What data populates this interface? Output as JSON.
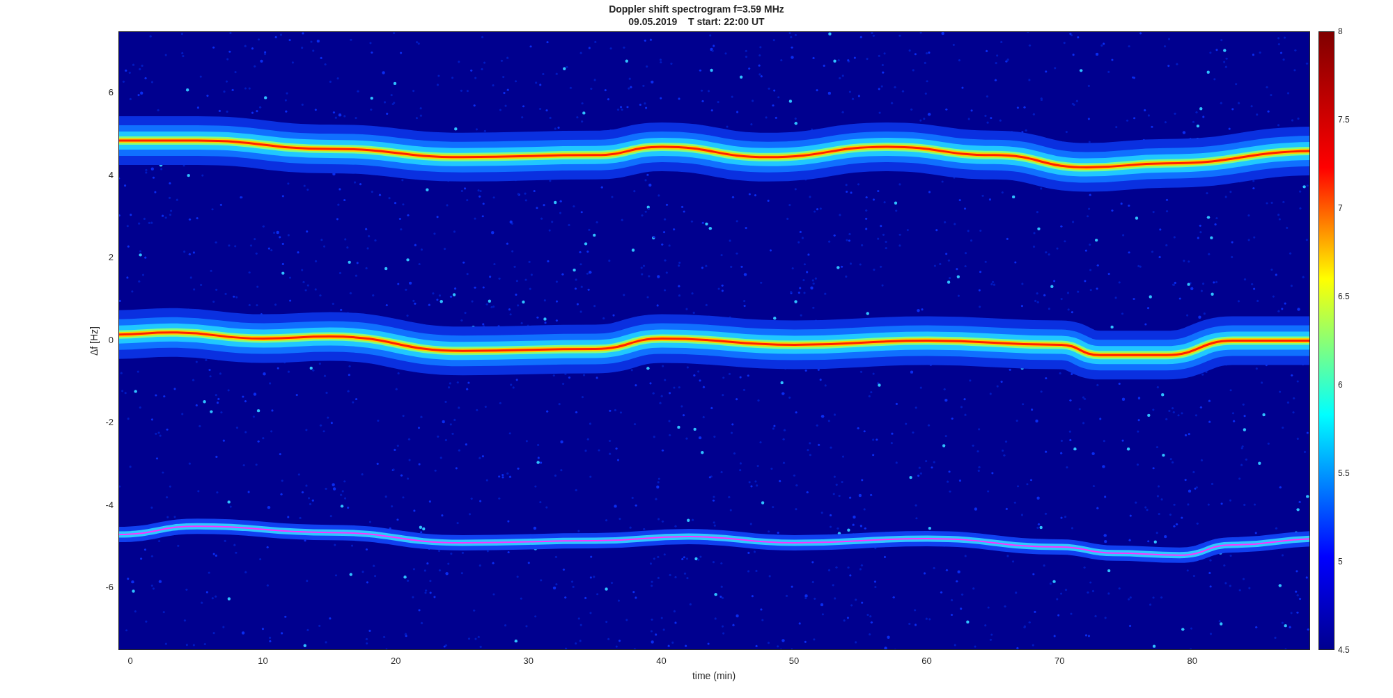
{
  "figure": {
    "title_lines": [
      "Doppler shift spectrogram f=3.59 MHz",
      "09.05.2019    T start: 22:00 UT"
    ]
  },
  "axes": {
    "xlabel": "time (min)",
    "ylabel": "Δf [Hz]",
    "xticks": [
      "0",
      "10",
      "20",
      "30",
      "40",
      "50",
      "60",
      "70",
      "80"
    ],
    "yticks": [
      "6",
      "4",
      "2",
      "0",
      "-2",
      "-4",
      "-6"
    ]
  },
  "colorbar": {
    "ticks": [
      "8",
      "7.5",
      "7",
      "6.5",
      "6",
      "5.5",
      "5",
      "4.5"
    ]
  }
}
